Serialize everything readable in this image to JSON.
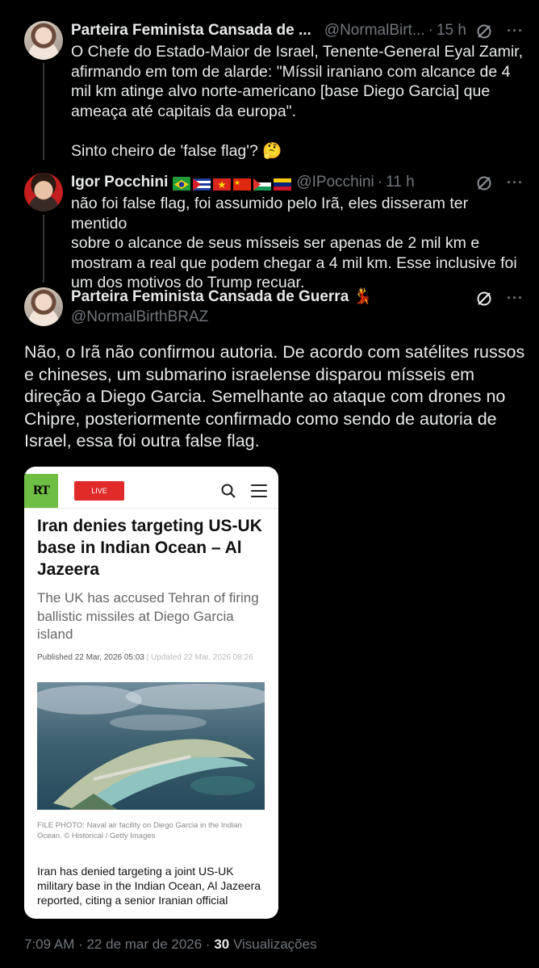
{
  "tweets": [
    {
      "display_name": "Parteira Feminista Cansada de ...",
      "handle": "@NormalBirt...",
      "time": "15 h",
      "text": "O Chefe do Estado-Maior de Israel, Tenente-General Eyal Zamir,\nafirmando em tom de alarde: \"Míssil iraniano com alcance de 4\nmil km atinge alvo norte-americano [base Diego Garcia] que\nameaça até capitais da europa\".\n\nSinto cheiro de 'false flag'? 🤔"
    },
    {
      "display_name": "Igor Pocchini",
      "flags": [
        "brazil-flag",
        "cuba-flag",
        "vietnam-flag",
        "china-flag",
        "palestine-flag",
        "venezuela-flag"
      ],
      "handle": "@IPocchini",
      "time": "11 h",
      "text": "não foi false flag, foi assumido pelo Irã, eles disseram ter mentido\nsobre o alcance de seus mísseis ser apenas de 2 mil km e\nmostram a real que podem chegar a 4 mil km. Esse inclusive foi\num dos motivos do Trump recuar."
    }
  ],
  "main_tweet": {
    "display_name": "Parteira Feminista Cansada de Guerra 💃",
    "handle": "@NormalBirthBRAZ",
    "text": "Não, o Irã não confirmou autoria. De acordo com satélites russos\ne chineses, um submarino israelense disparou mísseis em\ndireção a Diego Garcia. Semelhante ao ataque com drones no\nChipre, posteriormente confirmado como sendo de autoria de\nIsrael, essa foi outra false flag.",
    "image": {
      "logo": "RT",
      "live_label": "LIVE",
      "headline": "Iran denies targeting US-UK base in Indian Ocean – Al Jazeera",
      "subhead": "The UK has accused Tehran of firing ballistic missiles at Diego Garcia island",
      "published": "Published 22 Mar, 2026 05:03",
      "updated": " | Updated 22 Mar, 2026 08:26",
      "caption": "FILE PHOTO: Naval air facility on Diego Garcia in the Indian Ocean. © Historical / Getty Images",
      "lead": "Iran has denied targeting a joint US-UK military base in the Indian Ocean, Al Jazeera reported, citing a senior Iranian official"
    },
    "timestamp": "7:09 AM · 22 de mar de 2026 · ",
    "views_count": "30",
    "views_label": " Visualizações"
  },
  "colors": {
    "background": "#000000",
    "text": "#e7e9ea",
    "secondary": "#71767b",
    "rt_green": "#6fbe44",
    "live_red": "#e12b2b"
  }
}
